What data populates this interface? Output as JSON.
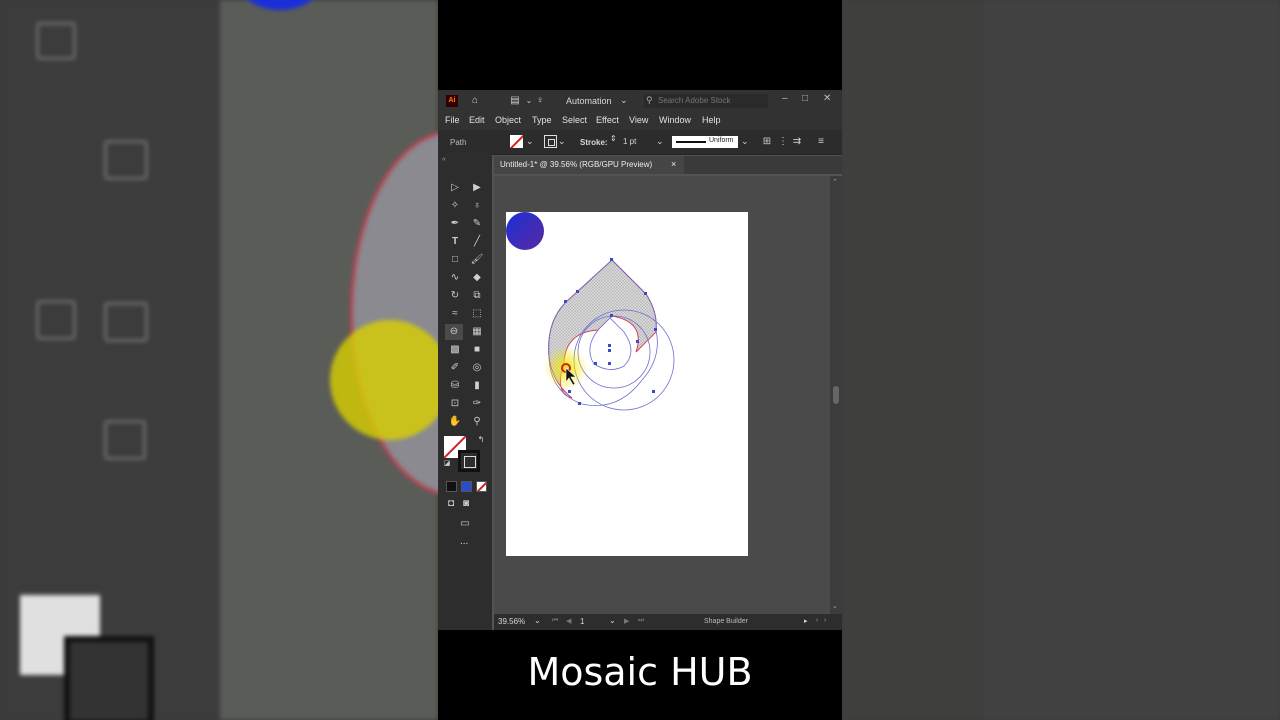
{
  "app": {
    "logo": "Ai",
    "workspace": "Automation",
    "search_placeholder": "Search Adobe Stock",
    "window_controls": {
      "minimize": "–",
      "maximize": "□",
      "close": "✕"
    }
  },
  "menu": [
    "File",
    "Edit",
    "Object",
    "Type",
    "Select",
    "Effect",
    "View",
    "Window",
    "Help"
  ],
  "control_bar": {
    "selection_type": "Path",
    "stroke_label": "Stroke:",
    "stroke_weight": "1 pt",
    "profile": "Uniform"
  },
  "document_tab": {
    "title": "Untitled-1* @ 39.56% (RGB/GPU Preview)",
    "close": "×"
  },
  "status_bar": {
    "zoom": "39.56%",
    "artboard_number": "1",
    "current_tool": "Shape Builder"
  },
  "toolbar": {
    "more": "..."
  },
  "caption": "Mosaic HUB",
  "colors": {
    "gradient_start": "#1a2fd8",
    "gradient_end": "#5a2aa0",
    "path_stroke": "#6a6fd0",
    "selected_stroke": "#d0405a",
    "highlight": "#f4e800"
  }
}
